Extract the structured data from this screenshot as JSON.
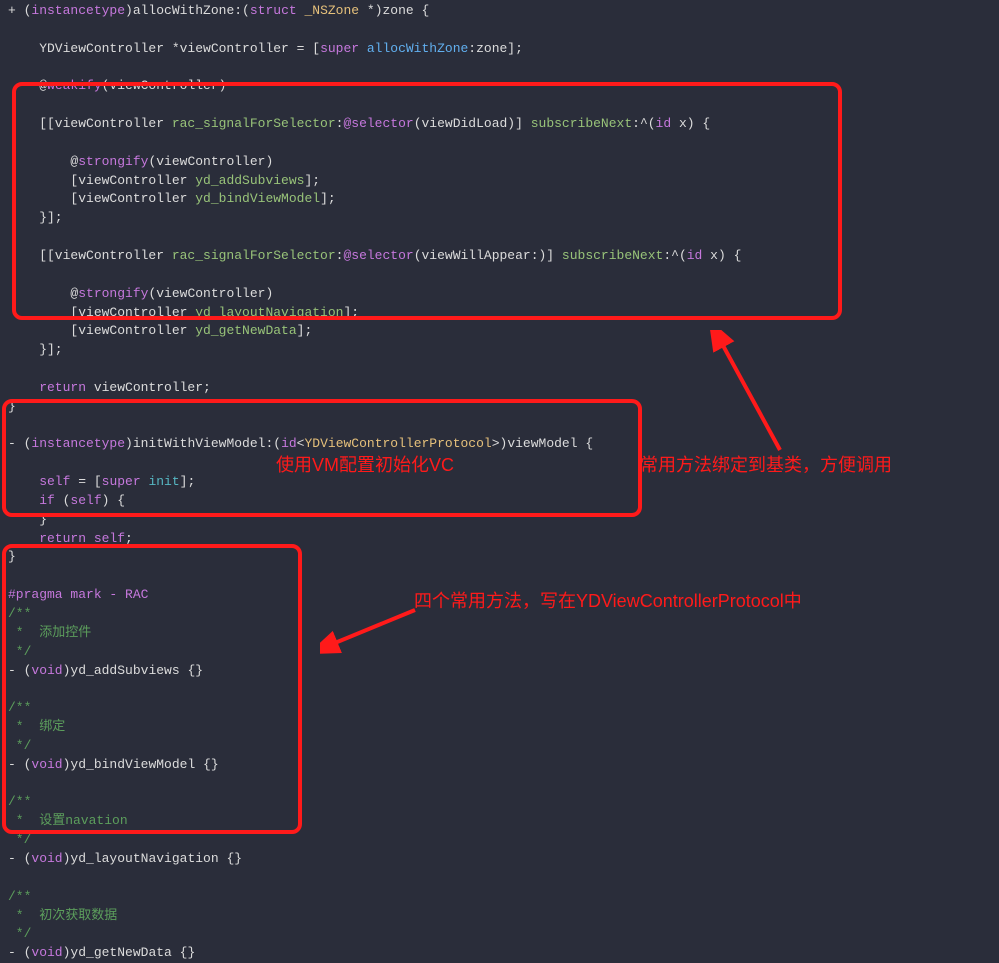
{
  "annotations": {
    "a1": "使用VM配置初始化VC",
    "a2": "常用方法绑定到基类，方便调用",
    "a3": "四个常用方法，写在YDViewControllerProtocol中"
  },
  "code": {
    "l1_plus": "+ (",
    "l1_type": "instancetype",
    "l1_mid": ")allocWithZone:(",
    "l1_struct": "struct",
    "l1_zone": " _NSZone ",
    "l1_end": "*)zone {",
    "l3_a": "    YDViewController *viewController = [",
    "l3_super": "super",
    "l3_msg": " allocWithZone",
    "l3_b": ":zone];",
    "l5_at": "    @",
    "l5_weak": "weakify",
    "l5_b": "(viewController)",
    "l7_a": "    [[viewController ",
    "l7_sig": "rac_signalForSelector",
    "l7_b": ":",
    "l7_sel": "@selector",
    "l7_c": "(viewDidLoad)] ",
    "l7_sub": "subscribeNext",
    "l7_d": ":^(",
    "l7_id": "id",
    "l7_e": " x) {",
    "l9_at": "        @",
    "l9_strong": "strongify",
    "l9_b": "(viewController)",
    "l10_a": "        [viewController ",
    "l10_m": "yd_addSubviews",
    "l10_b": "];",
    "l11_a": "        [viewController ",
    "l11_m": "yd_bindViewModel",
    "l11_b": "];",
    "l12": "    }];",
    "l14_a": "    [[viewController ",
    "l14_sig": "rac_signalForSelector",
    "l14_b": ":",
    "l14_sel": "@selector",
    "l14_c": "(viewWillAppear:)] ",
    "l14_sub": "subscribeNext",
    "l14_d": ":^(",
    "l14_id": "id",
    "l14_e": " x) {",
    "l16_at": "        @",
    "l16_strong": "strongify",
    "l16_b": "(viewController)",
    "l17_a": "        [viewController ",
    "l17_m": "yd_layoutNavigation",
    "l17_b": "];",
    "l18_a": "        [viewController ",
    "l18_m": "yd_getNewData",
    "l18_b": "];",
    "l19": "    }];",
    "l21_ret": "    return",
    "l21_b": " viewController;",
    "l22": "}",
    "l24_a": "- (",
    "l24_type": "instancetype",
    "l24_b": ")initWithViewModel:(",
    "l24_id": "id",
    "l24_c": "<",
    "l24_proto": "YDViewControllerProtocol",
    "l24_d": ">)viewModel {",
    "l26_self": "    self",
    "l26_eq": " = [",
    "l26_super": "super",
    "l26_init": " init",
    "l26_b": "];",
    "l27_if": "    if",
    "l27_a": " (",
    "l27_self": "self",
    "l27_b": ") {",
    "l28": "    }",
    "l29_ret": "    return",
    "l29_self": " self",
    "l29_b": ";",
    "l30": "}",
    "l32_pragma": "#pragma mark - RAC",
    "c1_a": "/**",
    "c1_b": " *  添加控件",
    "c1_c": " */",
    "m1_a": "- (",
    "m1_void": "void",
    "m1_b": ")yd_addSubviews {}",
    "c2_a": "/**",
    "c2_b": " *  绑定",
    "c2_c": " */",
    "m2_a": "- (",
    "m2_void": "void",
    "m2_b": ")yd_bindViewModel {}",
    "c3_a": "/**",
    "c3_b": " *  设置navation",
    "c3_c": " */",
    "m3_a": "- (",
    "m3_void": "void",
    "m3_b": ")yd_layoutNavigation {}",
    "c4_a": "/**",
    "c4_b": " *  初次获取数据",
    "c4_c": " */",
    "m4_a": "- (",
    "m4_void": "void",
    "m4_b": ")yd_getNewData {}"
  }
}
